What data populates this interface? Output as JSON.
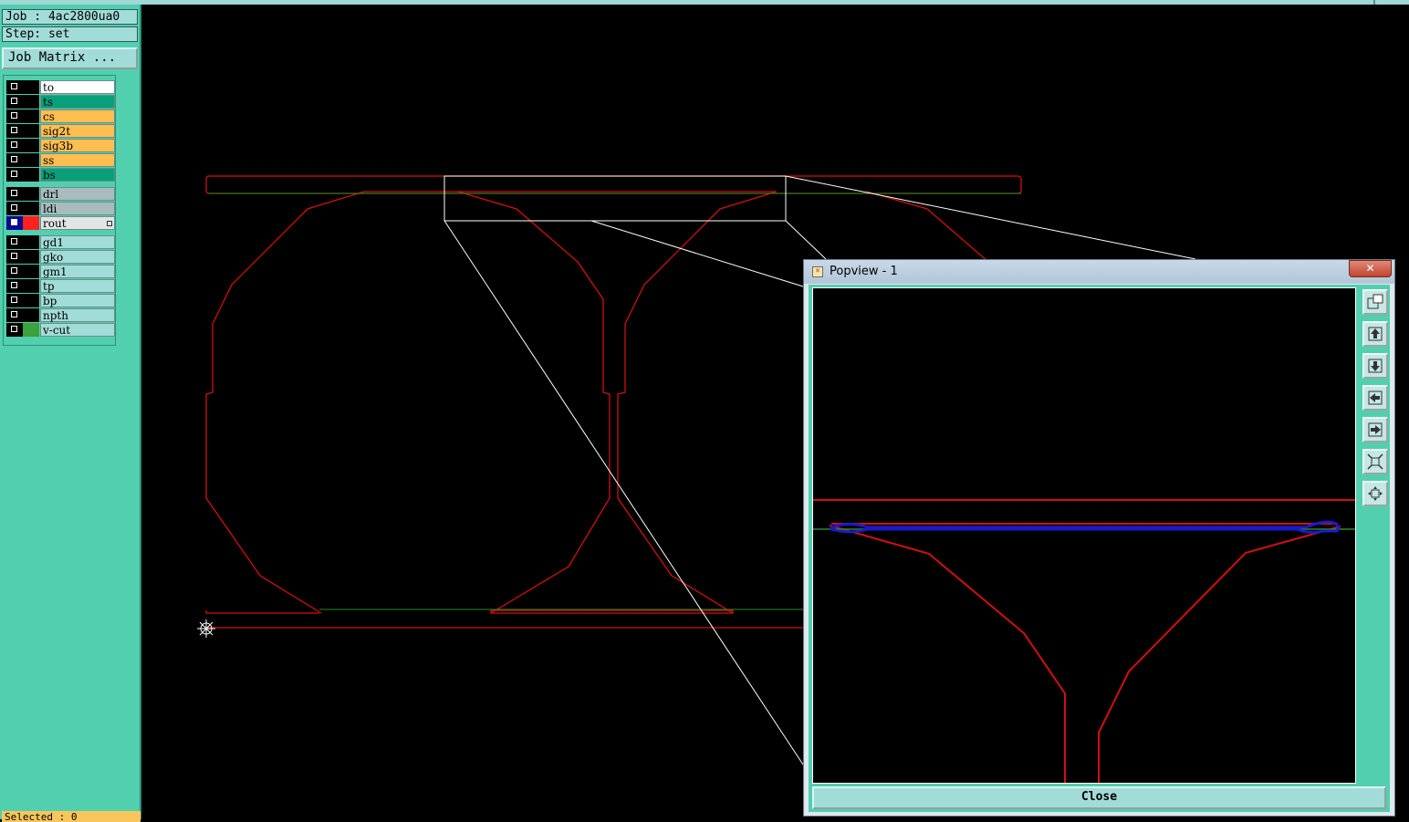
{
  "left_panel": {
    "job_label": "Job : 4ac2800ua0",
    "step_label": "Step: set",
    "job_matrix_button": "Job Matrix ...",
    "layers": [
      {
        "name": "to",
        "bg": "#ffffff",
        "swatch": "#000000"
      },
      {
        "name": "ts",
        "bg": "#08a07a",
        "swatch": "#000000"
      },
      {
        "name": "cs",
        "bg": "#ffbe50",
        "swatch": "#000000"
      },
      {
        "name": "sig2t",
        "bg": "#ffbe50",
        "swatch": "#000000"
      },
      {
        "name": "sig3b",
        "bg": "#ffbe50",
        "swatch": "#000000"
      },
      {
        "name": "ss",
        "bg": "#ffbe50",
        "swatch": "#000000"
      },
      {
        "name": "bs",
        "bg": "#08a07a",
        "swatch": "#000000"
      },
      {
        "name": "drl",
        "bg": "#a8bcc0",
        "swatch": "#000000"
      },
      {
        "name": "ldi",
        "bg": "#a8bcc0",
        "swatch": "#000000"
      },
      {
        "name": "rout",
        "bg": "#e4e4e4",
        "swatch": "#ff2020",
        "active": true
      },
      {
        "name": "gd1",
        "bg": "#a2dcd8",
        "swatch": "#000000"
      },
      {
        "name": "gko",
        "bg": "#a2dcd8",
        "swatch": "#000000"
      },
      {
        "name": "gm1",
        "bg": "#a2dcd8",
        "swatch": "#000000"
      },
      {
        "name": "tp",
        "bg": "#a2dcd8",
        "swatch": "#000000"
      },
      {
        "name": "bp",
        "bg": "#a2dcd8",
        "swatch": "#000000"
      },
      {
        "name": "npth",
        "bg": "#a2dcd8",
        "swatch": "#000000"
      },
      {
        "name": "v-cut",
        "bg": "#a2dcd8",
        "swatch": "#3ca03c"
      }
    ],
    "selected_label": "Selected : 0"
  },
  "popview": {
    "title": "Popview - 1",
    "close_x": "✕",
    "close_button": "Close",
    "toolbar_icons": [
      "zoom-fit-icon",
      "pan-up-icon",
      "pan-down-icon",
      "pan-left-icon",
      "pan-right-icon",
      "zoom-out-icon",
      "zoom-home-icon"
    ]
  },
  "colors": {
    "panel": "#52cfae",
    "canvas": "#000000",
    "rout_line": "#d01010",
    "vcut_line": "#2a8a2a",
    "highlight": "#1a1acc"
  }
}
